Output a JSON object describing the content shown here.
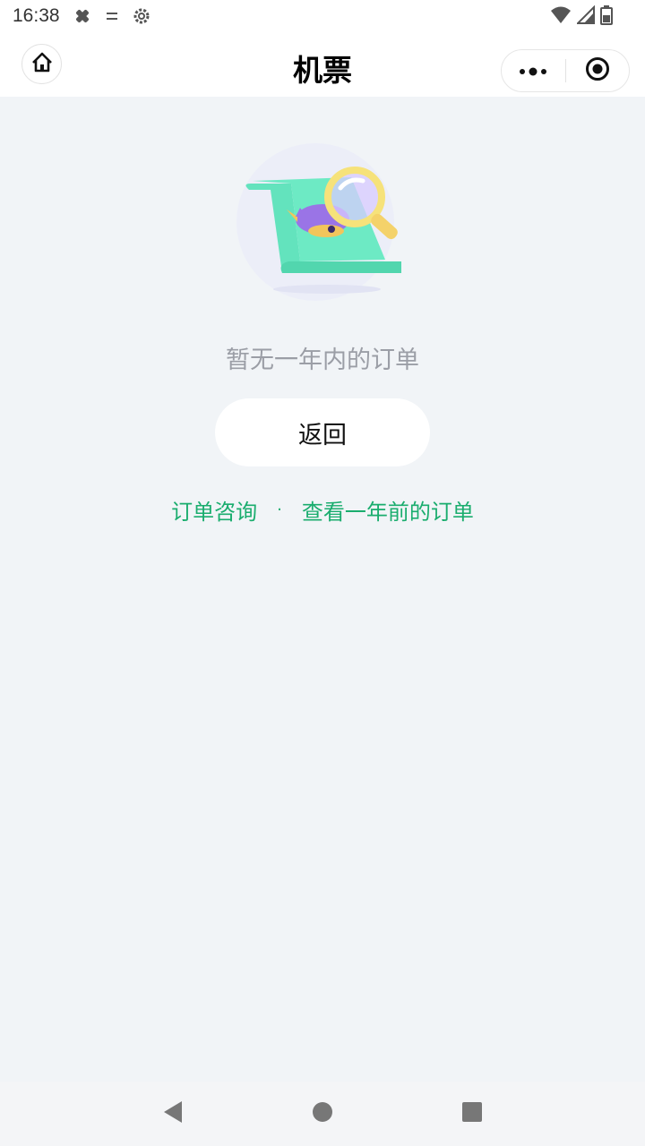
{
  "status_bar": {
    "time": "16:38",
    "icons": [
      "debug-icon",
      "sliders-icon",
      "settings-icon",
      "wifi-icon",
      "signal-icon",
      "battery-icon"
    ]
  },
  "nav_bar": {
    "title": "机票",
    "home_icon": "home-icon",
    "more_icon": "more-dots-icon",
    "close_icon": "target-close-icon"
  },
  "empty_state": {
    "message": "暂无一年内的订单",
    "illustration": "magnifier-document-illustration",
    "back_button_label": "返回"
  },
  "links": {
    "consult": "订单咨询",
    "separator": "·",
    "older_orders": "查看一年前的订单"
  },
  "colors": {
    "accent_green": "#1aad6e",
    "background": "#f1f4f7",
    "muted_text": "#9b9ea6"
  },
  "system_nav": {
    "back_icon": "triangle-back-icon",
    "home_icon": "circle-home-icon",
    "recents_icon": "square-recents-icon"
  }
}
